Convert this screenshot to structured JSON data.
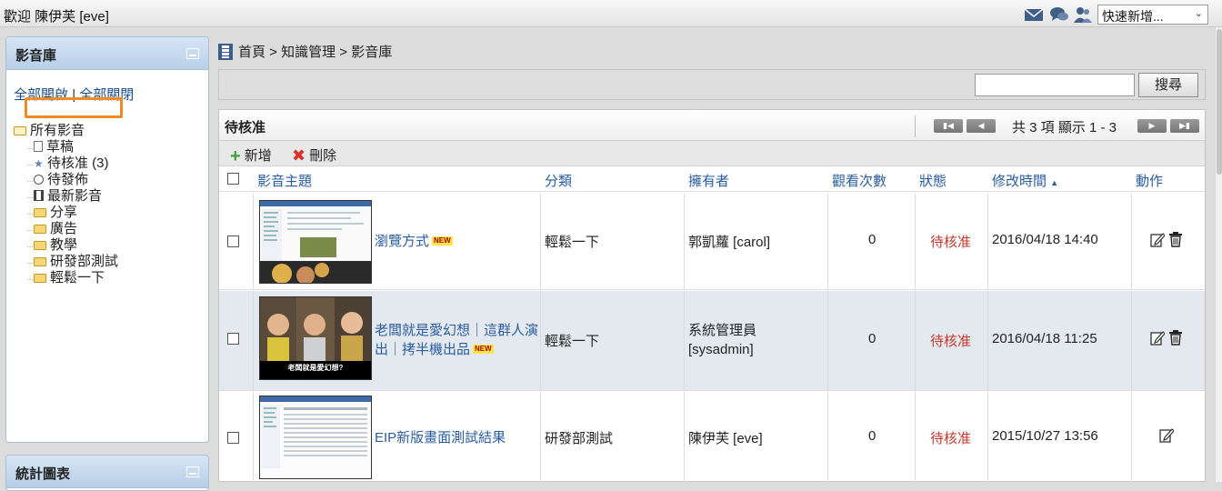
{
  "topbar": {
    "welcome": "歡迎 陳伊芙 [eve]",
    "icons": [
      "mail-icon",
      "chat-icon",
      "users-icon"
    ],
    "quick_add": "快速新增..."
  },
  "sidebar": {
    "title": "影音庫",
    "expand_all": "全部開啟",
    "separator": "|",
    "collapse_all": "全部關閉",
    "tree": {
      "root": "所有影音",
      "items": [
        {
          "label": "草稿",
          "icon": "draft-icon"
        },
        {
          "label": "待核准 (3)",
          "icon": "pending-icon",
          "selected": true
        },
        {
          "label": "待發佈",
          "icon": "clock-icon"
        },
        {
          "label": "最新影音",
          "icon": "film-icon"
        },
        {
          "label": "分享",
          "icon": "folder-icon"
        },
        {
          "label": "廣告",
          "icon": "folder-icon"
        },
        {
          "label": "教學",
          "icon": "folder-icon"
        },
        {
          "label": "研發部測試",
          "icon": "folder-icon"
        },
        {
          "label": "輕鬆一下",
          "icon": "folder-icon"
        }
      ]
    },
    "chart_panel_title": "統計圖表"
  },
  "main": {
    "breadcrumb": "首頁 > 知識管理 > 影音庫",
    "search_button": "搜尋",
    "search_value": "",
    "grid_title": "待核准",
    "pager_text": "共 3 項 顯示 1 - 3",
    "toolbar": {
      "add": "新增",
      "delete": "刪除"
    },
    "columns": [
      "影音主題",
      "分類",
      "擁有者",
      "觀看次數",
      "狀態",
      "修改時間",
      "動作"
    ],
    "sort_indicator": "▲",
    "new_badge": "NEW",
    "rows": [
      {
        "title": "瀏覽方式",
        "is_new": true,
        "category": "輕鬆一下",
        "owner": "郭凱蘿 [carol]",
        "views": "0",
        "status": "待核准",
        "modified": "2016/04/18 14:40",
        "can_delete": true
      },
      {
        "title": "老闆就是愛幻想｜這群人演出｜拷半機出品",
        "is_new": true,
        "category": "輕鬆一下",
        "owner": "系統管理員 [sysadmin]",
        "views": "0",
        "status": "待核准",
        "modified": "2016/04/18 11:25",
        "can_delete": true,
        "thumb_caption": "老闆就是愛幻想?"
      },
      {
        "title": "EIP新版畫面測試結果",
        "is_new": false,
        "category": "研發部測試",
        "owner": "陳伊芙 [eve]",
        "views": "0",
        "status": "待核准",
        "modified": "2015/10/27 13:56",
        "can_delete": false
      }
    ]
  },
  "colors": {
    "accent": "#2a5d9e",
    "status": "#c0392b",
    "selected_outline": "#f08a24"
  }
}
